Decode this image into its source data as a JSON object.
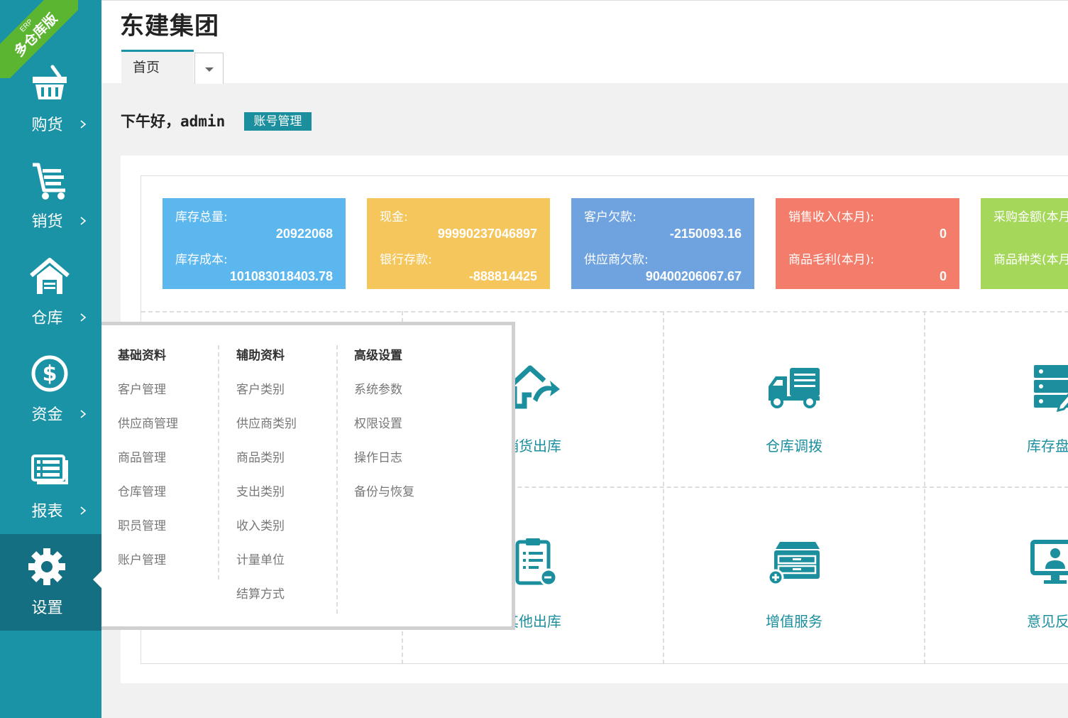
{
  "badge": {
    "top": "ERP",
    "main": "多仓库版"
  },
  "sidebar": {
    "items": [
      {
        "label": "购货",
        "icon": "basket-icon"
      },
      {
        "label": "销货",
        "icon": "cart-icon"
      },
      {
        "label": "仓库",
        "icon": "warehouse-icon"
      },
      {
        "label": "资金",
        "icon": "dollar-icon"
      },
      {
        "label": "报表",
        "icon": "report-icon"
      },
      {
        "label": "设置",
        "icon": "gear-icon",
        "active": true
      }
    ]
  },
  "header": {
    "company": "东建集团",
    "tab_home": "首页"
  },
  "greeting": {
    "text": "下午好，admin",
    "account_button": "账号管理"
  },
  "stats": [
    {
      "label1": "库存总量:",
      "value1": "20922068",
      "label2": "库存成本:",
      "value2": "101083018403.78",
      "color": "#5db7ef"
    },
    {
      "label1": "现金:",
      "value1": "99990237046897",
      "label2": "银行存款:",
      "value2": "-888814425",
      "color": "#f4c65c"
    },
    {
      "label1": "客户欠款:",
      "value1": "-2150093.16",
      "label2": "供应商欠款:",
      "value2": "90400206067.67",
      "color": "#6fa3e0"
    },
    {
      "label1": "销售收入(本月):",
      "value1": "0",
      "label2": "商品毛利(本月):",
      "value2": "0",
      "color": "#f47c6a"
    },
    {
      "label1": "采购金额(本月):",
      "value1": "",
      "label2": "商品种类(本月):",
      "value2": "",
      "color": "#a5d85a"
    }
  ],
  "tiles": {
    "row1": [
      "",
      "销货出库",
      "仓库调拨",
      "库存盘点"
    ],
    "row2": [
      "",
      "其他出库",
      "增值服务",
      "意见反馈"
    ],
    "icons": {
      "sales_out": "house-arrow-icon",
      "transfer": "truck-icon",
      "inventory": "server-edit-icon",
      "other_out": "clipboard-icon",
      "value_added": "drawer-icon",
      "feedback": "monitor-user-icon"
    }
  },
  "menu": {
    "col1": {
      "head": "基础资料",
      "items": [
        "客户管理",
        "供应商管理",
        "商品管理",
        "仓库管理",
        "职员管理",
        "账户管理"
      ]
    },
    "col2": {
      "head": "辅助资料",
      "items": [
        "客户类别",
        "供应商类别",
        "商品类别",
        "支出类别",
        "收入类别",
        "计量单位",
        "结算方式"
      ]
    },
    "col3": {
      "head": "高级设置",
      "items": [
        "系统参数",
        "权限设置",
        "操作日志",
        "备份与恢复"
      ]
    }
  },
  "colors": {
    "sidebar": "#1b93a6",
    "sidebar_active": "#156f82",
    "accent": "#1b8f9e",
    "badge": "#5cb531"
  }
}
